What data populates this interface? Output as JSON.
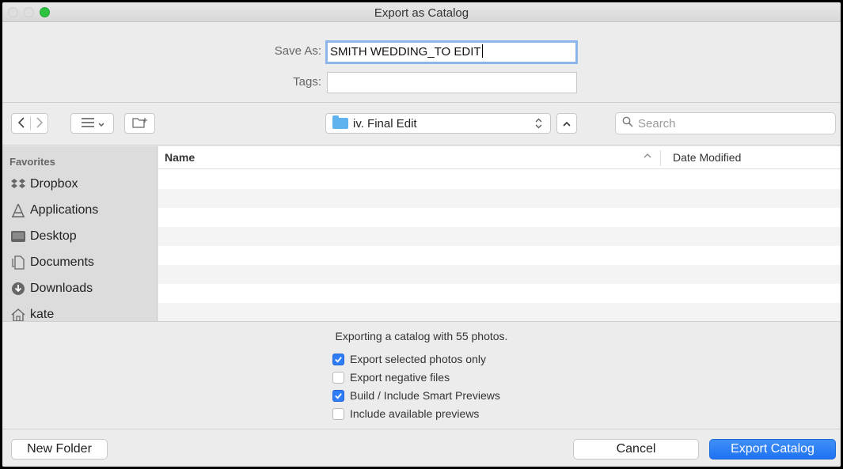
{
  "window": {
    "title": "Export as Catalog"
  },
  "save": {
    "save_as_label": "Save As:",
    "save_as_value": "SMITH WEDDING_TO EDIT",
    "tags_label": "Tags:",
    "tags_value": ""
  },
  "toolbar": {
    "back_icon": "chevron-left-icon",
    "forward_icon": "chevron-right-icon",
    "view_icon": "list-view-icon",
    "new_folder_icon": "new-folder-icon",
    "location": "iv. Final Edit",
    "search_placeholder": "Search"
  },
  "sidebar": {
    "heading": "Favorites",
    "items": [
      {
        "label": "Dropbox",
        "icon": "dropbox-icon"
      },
      {
        "label": "Applications",
        "icon": "applications-icon"
      },
      {
        "label": "Desktop",
        "icon": "desktop-icon"
      },
      {
        "label": "Documents",
        "icon": "documents-icon"
      },
      {
        "label": "Downloads",
        "icon": "downloads-icon"
      },
      {
        "label": "kate",
        "icon": "home-icon"
      }
    ]
  },
  "filelist": {
    "col_name": "Name",
    "col_date": "Date Modified",
    "rows": []
  },
  "options": {
    "summary": "Exporting a catalog with 55 photos.",
    "checkboxes": [
      {
        "label": "Export selected photos only",
        "checked": true
      },
      {
        "label": "Export negative files",
        "checked": false
      },
      {
        "label": "Build / Include Smart Previews",
        "checked": true
      },
      {
        "label": "Include available previews",
        "checked": false
      }
    ]
  },
  "footer": {
    "new_folder": "New Folder",
    "cancel": "Cancel",
    "export": "Export Catalog"
  },
  "colors": {
    "accent": "#2e7cf6",
    "zoom": "#2fc240",
    "folder": "#5fb3ee"
  }
}
